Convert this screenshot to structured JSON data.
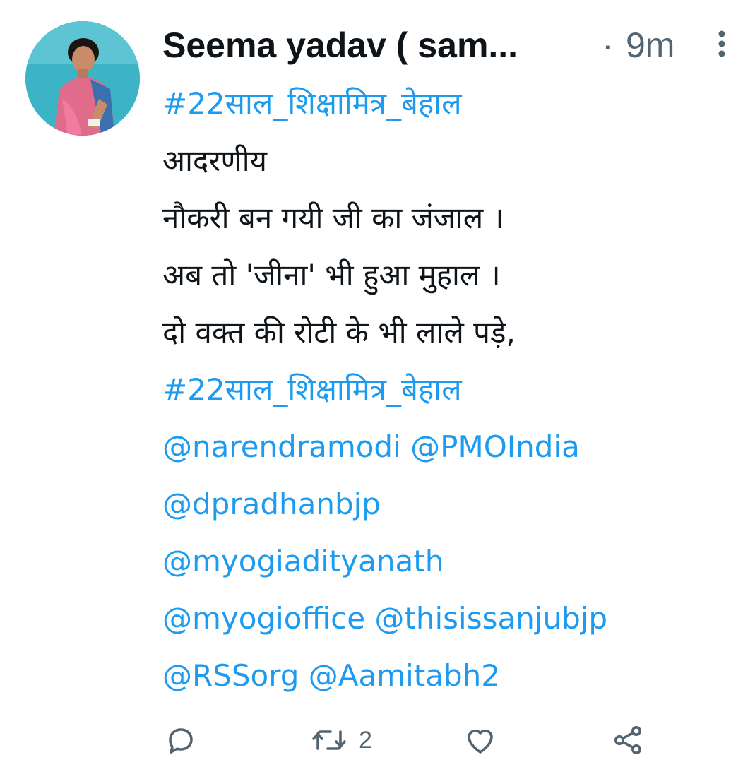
{
  "tweet": {
    "author": {
      "display_name": "Seema yadav ( sam...",
      "avatar": "user-avatar-photo"
    },
    "separator": "·",
    "timestamp": "9m",
    "body": {
      "hashtag_top": "#22साल_शिक्षामित्र_बेहाल",
      "line1": "आदरणीय",
      "line2": "नौकरी बन गयी जी का जंजाल ।",
      "line3": "अब तो 'जीना' भी हुआ मुहाल ।",
      "line4": "दो वक्त की रोटी के भी लाले पड़े,",
      "hashtag_bottom": "#22साल_शिक्षामित्र_बेहाल",
      "mentions": [
        "@narendramodi",
        "@PMOIndia",
        "@dpradhanbjp",
        "@myogiadityanath",
        "@myogioffice",
        "@thisissanjubjp",
        "@RSSorg",
        "@Aamitabh2"
      ]
    },
    "actions": {
      "reply_icon": "reply-icon",
      "retweet_icon": "retweet-icon",
      "retweet_count": "2",
      "like_icon": "heart-icon",
      "share_icon": "share-icon"
    },
    "colors": {
      "link": "#1d9bf0",
      "text": "#0f1419",
      "muted": "#536471"
    }
  }
}
